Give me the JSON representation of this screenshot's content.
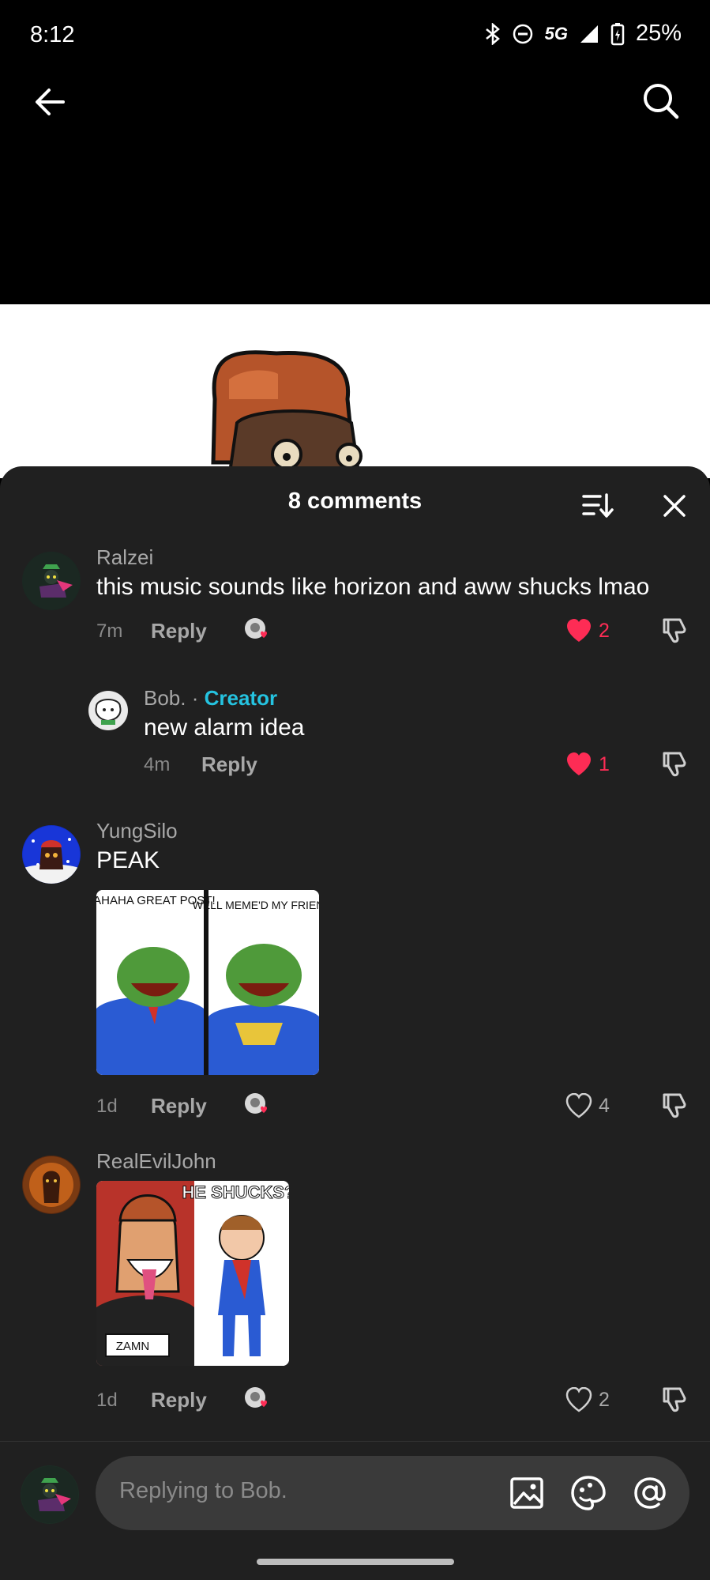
{
  "status_bar": {
    "time": "8:12",
    "network": "5G",
    "battery": "25%"
  },
  "sheet": {
    "title": "8 comments"
  },
  "comments": [
    {
      "username": "Ralzei",
      "text": "this music sounds like horizon and aww shucks lmao",
      "time": "7m",
      "reply_label": "Reply",
      "likes": "2",
      "liked": true
    },
    {
      "username": "Bob.",
      "separator": " · ",
      "badge": "Creator",
      "text": "new alarm idea",
      "time": "4m",
      "reply_label": "Reply",
      "likes": "1",
      "liked": true
    },
    {
      "username": "YungSilo",
      "text": "PEAK",
      "image_captions": [
        "HAHAHA GREAT POST!",
        "WELL MEME'D MY FRIEND!"
      ],
      "time": "1d",
      "reply_label": "Reply",
      "likes": "4",
      "liked": false
    },
    {
      "username": "RealEvilJohn",
      "image_captions": [
        "ZAMN",
        "HE SHUCKS?"
      ],
      "time": "1d",
      "reply_label": "Reply",
      "likes": "2",
      "liked": false
    }
  ],
  "input": {
    "placeholder": "Replying to Bob."
  },
  "colors": {
    "sheet_bg": "#202020",
    "like_red": "#fe2c55",
    "creator_cyan": "#25c3e0",
    "muted": "#a8a8a8"
  },
  "icons": [
    "back-arrow-icon",
    "search-icon",
    "sort-icon",
    "close-icon",
    "heart-icon",
    "dislike-icon",
    "image-icon",
    "emoji-icon",
    "mention-icon"
  ]
}
